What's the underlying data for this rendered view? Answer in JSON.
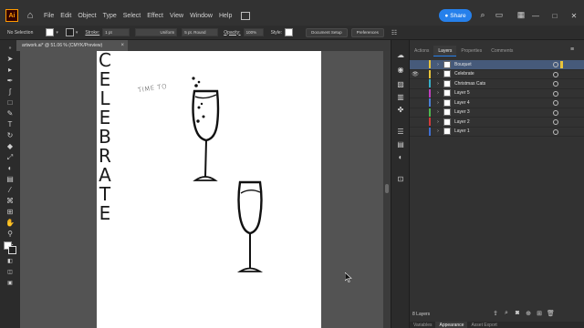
{
  "menubar": {
    "app_logo": "Ai",
    "menus": [
      "File",
      "Edit",
      "Object",
      "Type",
      "Select",
      "Effect",
      "View",
      "Window",
      "Help"
    ],
    "share_label": "Share"
  },
  "controlbar": {
    "selection": "No Selection",
    "stroke_label": "Stroke:",
    "stroke_value": "1 pt",
    "profile_value": "Uniform",
    "brush_value": "5 pt. Round",
    "opacity_label": "Opacity:",
    "opacity_value": "100%",
    "style_label": "Style:",
    "doc_setup": "Document Setup",
    "preferences": "Preferences"
  },
  "document": {
    "tab_title": "artwork.ai* @ 51.06 % (CMYK/Preview)",
    "close": "×"
  },
  "artwork": {
    "top_text": "TIME TO",
    "word_letters": [
      "C",
      "E",
      "L",
      "E",
      "B",
      "R",
      "A",
      "T",
      "E"
    ]
  },
  "panel": {
    "tabs": [
      "Actions",
      "Layers",
      "Properties",
      "Comments"
    ],
    "active_tab": "Layers",
    "layer_count": "8 Layers",
    "bottom_tabs": [
      "Variables",
      "Appearance",
      "Asset Export"
    ],
    "layers": [
      {
        "name": "Bouquet",
        "color": "#e8c33a",
        "visible": false,
        "selected": true
      },
      {
        "name": "Celebrate",
        "color": "#e8c33a",
        "visible": true,
        "selected": false
      },
      {
        "name": "Christmas Cats",
        "color": "#37b0c9",
        "visible": false,
        "selected": false
      },
      {
        "name": "Layer 5",
        "color": "#c03fbf",
        "visible": false,
        "selected": false
      },
      {
        "name": "Layer 4",
        "color": "#4a7fd6",
        "visible": false,
        "selected": false
      },
      {
        "name": "Layer 3",
        "color": "#4fb84f",
        "visible": false,
        "selected": false
      },
      {
        "name": "Layer 2",
        "color": "#d23a3a",
        "visible": false,
        "selected": false
      },
      {
        "name": "Layer 1",
        "color": "#3f6fd1",
        "visible": false,
        "selected": false
      }
    ]
  },
  "colors": {
    "accent": "#2680eb",
    "canvas": "#535353",
    "artboard": "#ffffff"
  }
}
